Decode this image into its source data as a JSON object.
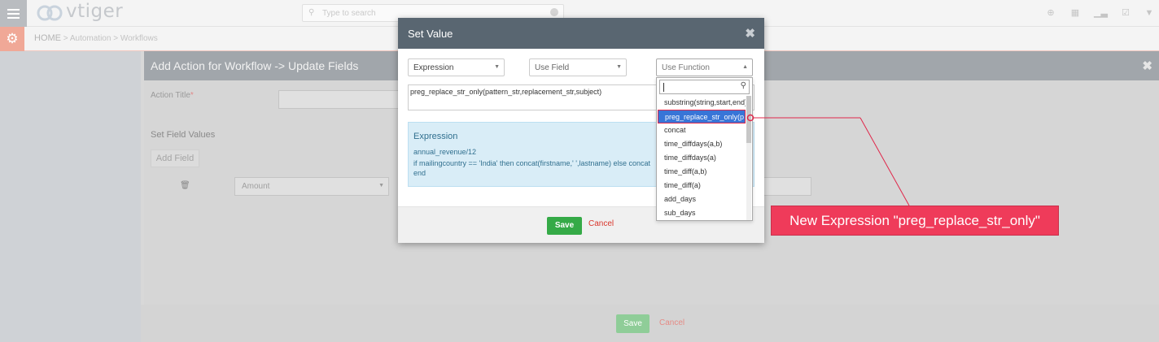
{
  "app": {
    "brand": "vtiger",
    "search_placeholder": "Type to search"
  },
  "breadcrumb": {
    "home": "HOME",
    "path": " > Automation > Workflows"
  },
  "panel": {
    "title": "Add Action for Workflow -> Update Fields",
    "action_title_label": "Action Title",
    "required_mark": "*",
    "set_field_values_label": "Set Field Values",
    "add_field_label": "Add Field",
    "field_select_value": "Amount",
    "save_label": "Save",
    "cancel_label": "Cancel"
  },
  "modal": {
    "title": "Set Value",
    "type_select": "Expression",
    "use_field_select": "Use Field",
    "use_function_select": "Use Function",
    "expression_value": "preg_replace_str_only(pattern_str,replacement_str,subject)",
    "help_title": "Expression",
    "help_lines": [
      "annual_revenue/12",
      "if mailingcountry == 'India' then concat(firstname,' ',lastname) else concat",
      "end"
    ],
    "save_label": "Save",
    "cancel_label": "Cancel"
  },
  "function_dropdown": {
    "options": [
      "substring(string,start,end)",
      "preg_replace_str_only(p",
      "concat",
      "time_diffdays(a,b)",
      "time_diffdays(a)",
      "time_diff(a,b)",
      "time_diff(a)",
      "add_days",
      "sub_days"
    ],
    "highlighted_index": 1
  },
  "callout": {
    "text": "New Expression \"preg_replace_str_only\""
  },
  "colors": {
    "callout_bg": "#ef3b5a",
    "highlight": "#3875d7",
    "save_green": "#35aa47",
    "modal_header": "#596671"
  }
}
